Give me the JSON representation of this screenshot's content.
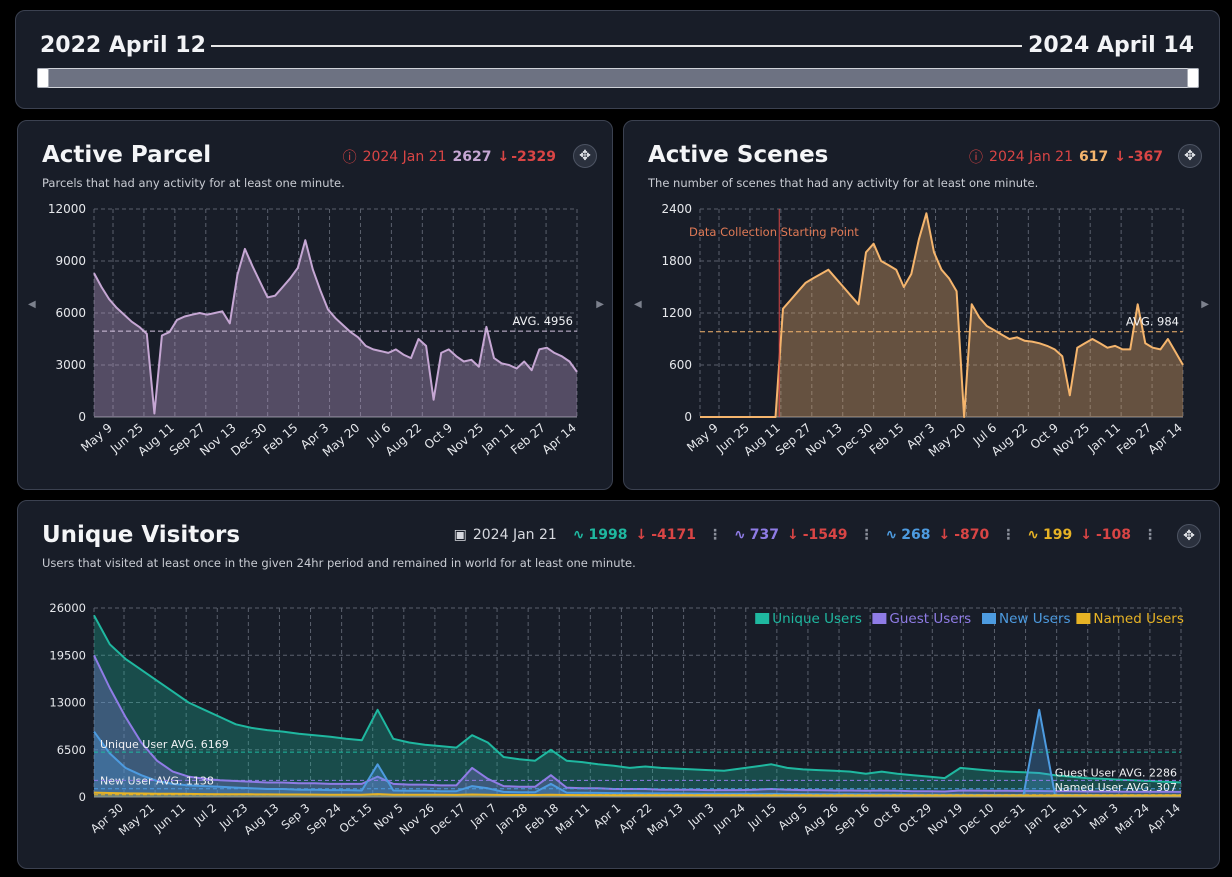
{
  "range": {
    "start": "2022 April 12",
    "end": "2024 April 14"
  },
  "panels": {
    "parcel": {
      "title": "Active Parcel",
      "subtitle": "Parcels that had any activity for at least one minute.",
      "date": "2024 Jan 21",
      "value": "2627",
      "change": "-2329",
      "color": "#c6a7d4"
    },
    "scenes": {
      "title": "Active Scenes",
      "subtitle": "The number of scenes that had any activity for at least one minute.",
      "date": "2024 Jan 21",
      "value": "617",
      "change": "-367",
      "color": "#f5b56d"
    },
    "visitors": {
      "title": "Unique Visitors",
      "subtitle": "Users that visited at least once in the given 24hr period and remained in world for at least one minute.",
      "date": "2024 Jan 21",
      "stats": [
        {
          "value": "1998",
          "change": "-4171",
          "color": "#1fb8a0"
        },
        {
          "value": "737",
          "change": "-1549",
          "color": "#8f7ce6"
        },
        {
          "value": "268",
          "change": "-870",
          "color": "#4d9be0"
        },
        {
          "value": "199",
          "change": "-108",
          "color": "#e7b325"
        }
      ]
    }
  },
  "chart_data": [
    {
      "type": "area",
      "title": "Active Parcel",
      "x_ticks": [
        "May 9",
        "Jun 25",
        "Aug 11",
        "Sep 27",
        "Nov 13",
        "Dec 30",
        "Feb 15",
        "Apr 3",
        "May 20",
        "Jul 6",
        "Aug 22",
        "Oct 9",
        "Nov 25",
        "Jan 11",
        "Feb 27",
        "Apr 14"
      ],
      "y_ticks": [
        "12000",
        "9000",
        "6000",
        "3000",
        "0"
      ],
      "ylim": [
        0,
        12000
      ],
      "average": {
        "label": "AVG. 4956",
        "value": 4956
      },
      "grid": true,
      "series": [
        {
          "color": "#c6a7d4",
          "values": [
            8300,
            7500,
            6800,
            6300,
            5900,
            5500,
            5200,
            4800,
            200,
            4700,
            4900,
            5600,
            5800,
            5900,
            6000,
            5900,
            6000,
            6100,
            5400,
            8200,
            9700,
            8700,
            7800,
            6900,
            7000,
            7500,
            8000,
            8600,
            10200,
            8500,
            7300,
            6200,
            5700,
            5300,
            4900,
            4600,
            4100,
            3900,
            3800,
            3700,
            3900,
            3600,
            3400,
            4500,
            4100,
            1000,
            3700,
            3900,
            3500,
            3200,
            3300,
            2900,
            5200,
            3400,
            3100,
            3000,
            2800,
            3200,
            2700,
            3900,
            4000,
            3700,
            3500,
            3200,
            2600
          ]
        }
      ]
    },
    {
      "type": "area",
      "title": "Active Scenes",
      "x_ticks": [
        "May 9",
        "Jun 25",
        "Aug 11",
        "Sep 27",
        "Nov 13",
        "Dec 30",
        "Feb 15",
        "Apr 3",
        "May 20",
        "Jul 6",
        "Aug 22",
        "Oct 9",
        "Nov 25",
        "Jan 11",
        "Feb 27",
        "Apr 14"
      ],
      "y_ticks": [
        "2400",
        "1800",
        "1200",
        "600",
        "0"
      ],
      "ylim": [
        0,
        2400
      ],
      "average": {
        "label": "AVG. 984",
        "value": 984
      },
      "annotation": "Data Collection Starting Point",
      "grid": true,
      "series": [
        {
          "color": "#f5b56d",
          "values": [
            0,
            0,
            0,
            0,
            0,
            0,
            0,
            0,
            0,
            0,
            0,
            1250,
            1350,
            1450,
            1550,
            1600,
            1650,
            1700,
            1600,
            1500,
            1400,
            1300,
            1900,
            2000,
            1800,
            1750,
            1700,
            1500,
            1650,
            2050,
            2350,
            1900,
            1700,
            1600,
            1450,
            0,
            1300,
            1150,
            1050,
            1000,
            950,
            900,
            920,
            880,
            870,
            850,
            820,
            780,
            700,
            250,
            800,
            850,
            900,
            850,
            800,
            820,
            780,
            780,
            1300,
            850,
            800,
            780,
            900,
            750,
            600
          ]
        }
      ]
    },
    {
      "type": "area",
      "title": "Unique Visitors",
      "x_ticks": [
        "Apr 30",
        "May 21",
        "Jun 11",
        "Jul 2",
        "Jul 23",
        "Aug 13",
        "Sep 3",
        "Sep 24",
        "Oct 15",
        "Nov 5",
        "Nov 26",
        "Dec 17",
        "Jan 7",
        "Jan 28",
        "Feb 18",
        "Mar 11",
        "Apr 1",
        "Apr 22",
        "May 13",
        "Jun 3",
        "Jun 24",
        "Jul 15",
        "Aug 5",
        "Aug 26",
        "Sep 16",
        "Oct 8",
        "Oct 29",
        "Nov 19",
        "Dec 10",
        "Dec 31",
        "Jan 21",
        "Feb 11",
        "Mar 3",
        "Mar 24",
        "Apr 14"
      ],
      "y_ticks": [
        "26000",
        "19500",
        "13000",
        "6500",
        "0"
      ],
      "ylim": [
        0,
        26000
      ],
      "legend": "top-right",
      "grid": true,
      "averages": [
        {
          "label": "Unique User AVG. 6169",
          "value": 6169
        },
        {
          "label": "New User AVG. 1138",
          "value": 1138
        },
        {
          "label": "Guest User AVG. 2286",
          "value": 2286
        },
        {
          "label": "Named User AVG. 307",
          "value": 307
        }
      ],
      "series": [
        {
          "name": "Unique Users",
          "color": "#1fb8a0",
          "values": [
            25000,
            21000,
            19000,
            17500,
            16000,
            14500,
            13000,
            12000,
            11000,
            10000,
            9500,
            9200,
            9000,
            8700,
            8500,
            8300,
            8000,
            7800,
            12000,
            8000,
            7500,
            7200,
            7000,
            6800,
            8500,
            7500,
            5500,
            5200,
            5000,
            6500,
            5000,
            4800,
            4500,
            4300,
            4000,
            4200,
            4000,
            3900,
            3800,
            3700,
            3600,
            3900,
            4200,
            4500,
            4000,
            3800,
            3700,
            3600,
            3500,
            3200,
            3500,
            3200,
            3000,
            2800,
            2600,
            4000,
            3800,
            3600,
            3500,
            3400,
            3300,
            3000,
            2800,
            2600,
            2500,
            2400,
            2300,
            2200,
            2100,
            2000
          ]
        },
        {
          "name": "Guest Users",
          "color": "#8f7ce6",
          "values": [
            19500,
            15000,
            11000,
            7500,
            5000,
            3500,
            2800,
            2500,
            2300,
            2200,
            2100,
            2000,
            2000,
            1900,
            1900,
            1800,
            1800,
            1800,
            2800,
            1800,
            1700,
            1700,
            1600,
            1600,
            4000,
            2500,
            1500,
            1400,
            1400,
            3000,
            1300,
            1200,
            1200,
            1100,
            1100,
            1100,
            1000,
            1000,
            1000,
            950,
            950,
            950,
            1000,
            1100,
            1000,
            950,
            950,
            900,
            900,
            850,
            900,
            850,
            800,
            780,
            760,
            900,
            880,
            860,
            850,
            840,
            830,
            800,
            780,
            760,
            750,
            740,
            730,
            720,
            710,
            700
          ]
        },
        {
          "name": "New Users",
          "color": "#4d9be0",
          "values": [
            9000,
            6000,
            4000,
            3000,
            2200,
            1800,
            1600,
            1500,
            1400,
            1300,
            1200,
            1100,
            1100,
            1000,
            1000,
            950,
            950,
            900,
            4500,
            900,
            850,
            850,
            800,
            800,
            1500,
            1200,
            700,
            650,
            650,
            1800,
            600,
            580,
            560,
            540,
            520,
            500,
            490,
            480,
            470,
            460,
            450,
            440,
            430,
            420,
            410,
            400,
            390,
            380,
            370,
            360,
            350,
            340,
            330,
            320,
            310,
            300,
            290,
            280,
            270,
            260,
            12000,
            300,
            280,
            270,
            260,
            250,
            250,
            240,
            240,
            230
          ]
        },
        {
          "name": "Named Users",
          "color": "#e7b325",
          "values": [
            600,
            550,
            500,
            480,
            460,
            440,
            420,
            400,
            390,
            380,
            370,
            360,
            350,
            340,
            330,
            320,
            320,
            310,
            400,
            310,
            300,
            300,
            300,
            290,
            350,
            310,
            280,
            280,
            270,
            320,
            270,
            260,
            260,
            250,
            250,
            250,
            240,
            240,
            240,
            230,
            230,
            230,
            220,
            220,
            220,
            220,
            210,
            210,
            210,
            200,
            200,
            200,
            200,
            200,
            200,
            210,
            210,
            210,
            200,
            200,
            200,
            200,
            200,
            200,
            200,
            200,
            200,
            200,
            200,
            200
          ]
        }
      ]
    }
  ]
}
